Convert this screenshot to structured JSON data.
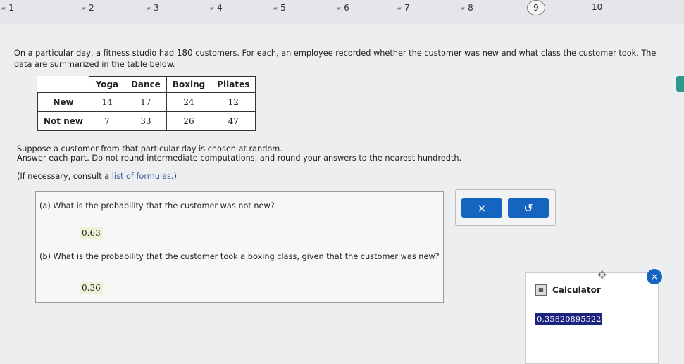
{
  "nav": {
    "items": [
      "1",
      "2",
      "3",
      "4",
      "5",
      "6",
      "7",
      "8",
      "9",
      "10"
    ]
  },
  "intro": {
    "part1": "On a particular day, a fitness studio had ",
    "customers": "180",
    "part2": " customers. For each, an employee recorded whether the customer was new and what class the customer took. The data are summarized in the table below."
  },
  "table": {
    "headers": [
      "Yoga",
      "Dance",
      "Boxing",
      "Pilates"
    ],
    "rows": [
      {
        "label": "New",
        "values": [
          "14",
          "17",
          "24",
          "12"
        ]
      },
      {
        "label": "Not new",
        "values": [
          "7",
          "33",
          "26",
          "47"
        ]
      }
    ]
  },
  "suppose": {
    "line1": "Suppose a customer from that particular day is chosen at random.",
    "line2": "Answer each part. Do not round intermediate computations, and round your answers to the nearest hundredth."
  },
  "formula": {
    "prefix": "(If necessary, consult a ",
    "link": "list of formulas",
    "suffix": ".)"
  },
  "questions": {
    "a_text": "(a) What is the probability that the customer was not new?",
    "a_answer": "0.63",
    "b_text": "(b) What is the probability that the customer took a boxing class, given that the customer was new?",
    "b_answer": "0.36"
  },
  "buttons": {
    "clear": "×",
    "undo": "↺"
  },
  "calculator": {
    "title": "Calculator",
    "display": "0.35820895522",
    "close": "×"
  },
  "colors": {
    "accent": "#1565c0",
    "display_bg": "#1a237e"
  }
}
